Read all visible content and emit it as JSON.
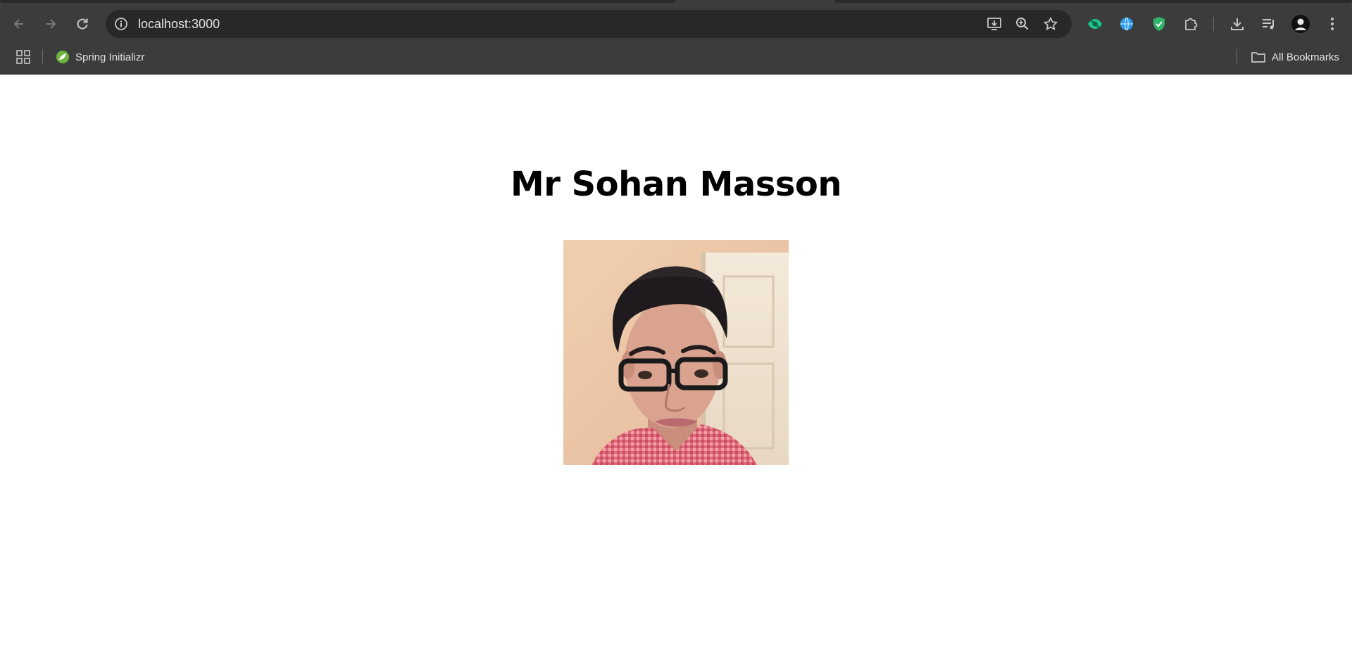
{
  "browser": {
    "url": "localhost:3000",
    "bookmarks": [
      {
        "label": "Spring Initializr",
        "icon": "spring-leaf-icon"
      }
    ],
    "all_bookmarks_label": "All Bookmarks"
  },
  "page": {
    "title": "Mr Sohan Masson",
    "photo_alt": "profile-photo"
  },
  "colors": {
    "chrome_bg": "#3c3c3c",
    "omnibox_bg": "#282828",
    "page_bg": "#ffffff",
    "title_text": "#000000"
  }
}
